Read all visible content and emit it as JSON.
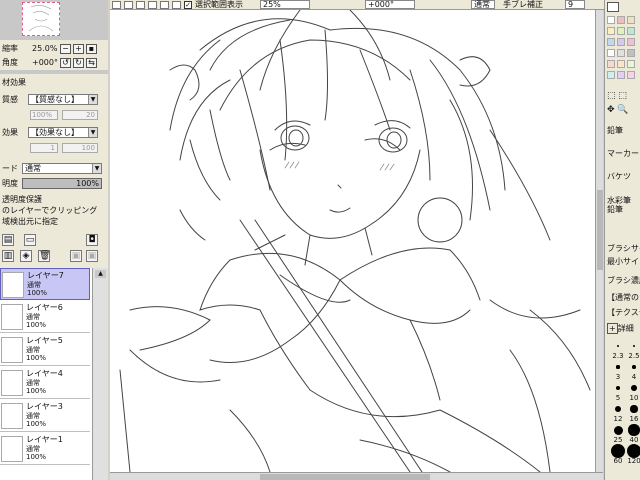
{
  "topbar": {
    "selection_label": "選択範囲表示",
    "selection_checked": true,
    "zoom_value": "25%",
    "angle_value": "+000°",
    "mode_value": "通常",
    "stabilizer_label": "手ブレ補正",
    "stabilizer_value": "9"
  },
  "left": {
    "scale_label": "縮率",
    "scale_value": "25.0%",
    "angle_label": "角度",
    "angle_value": "+000°",
    "material_header": "材効果",
    "texture_label": "質感",
    "texture_value": "【質感なし】",
    "texture_scale": "100%",
    "texture_strength": "20",
    "effect_label": "効果",
    "effect_value": "【効果なし】",
    "effect_width": "1",
    "effect_strength": "100",
    "mode_label": "ード",
    "mode_value": "通常",
    "opacity_label": "明度",
    "opacity_value": "100%",
    "opacity_fraction": 1.0,
    "options": [
      "透明度保護",
      "のレイヤーでクリッピング",
      "域検出元に指定"
    ],
    "layers": [
      {
        "name": "レイヤー7",
        "mode": "通常",
        "opacity": "100%",
        "selected": true
      },
      {
        "name": "レイヤー6",
        "mode": "通常",
        "opacity": "100%",
        "selected": false
      },
      {
        "name": "レイヤー5",
        "mode": "通常",
        "opacity": "100%",
        "selected": false
      },
      {
        "name": "レイヤー4",
        "mode": "通常",
        "opacity": "100%",
        "selected": false
      },
      {
        "name": "レイヤー3",
        "mode": "通常",
        "opacity": "100%",
        "selected": false
      },
      {
        "name": "レイヤー1",
        "mode": "通常",
        "opacity": "100%",
        "selected": false
      }
    ]
  },
  "right": {
    "swatches": [
      "#ffffff",
      "#e8c0c0",
      "#f0e0c0",
      "#f8f0c0",
      "#e0f0c0",
      "#c0e8d0",
      "#c0d8f0",
      "#d8c8f0",
      "#f0c0d8",
      "#ffffff",
      "#e0e0e0",
      "#c0c0c0",
      "#f8d8d0",
      "#f8e8c8",
      "#e8f8d0",
      "#d0f0f0",
      "#e0d0f8",
      "#f8d0e8"
    ],
    "tools": [
      "鉛筆",
      "マーカー",
      "バケツ",
      "水彩筆",
      "鉛筆"
    ],
    "brush_size_label": "ブラシサイ",
    "min_size_label": "最小サイ",
    "density_label": "ブラシ濃度",
    "normal_label": "【通常の",
    "texture_label": "【テクスチ",
    "detail_label": "詳細"
  },
  "brush_sizes": [
    "2.3",
    "2.5",
    "3",
    "4",
    "5",
    "10",
    "12",
    "16",
    "25",
    "40",
    "60",
    "120"
  ]
}
